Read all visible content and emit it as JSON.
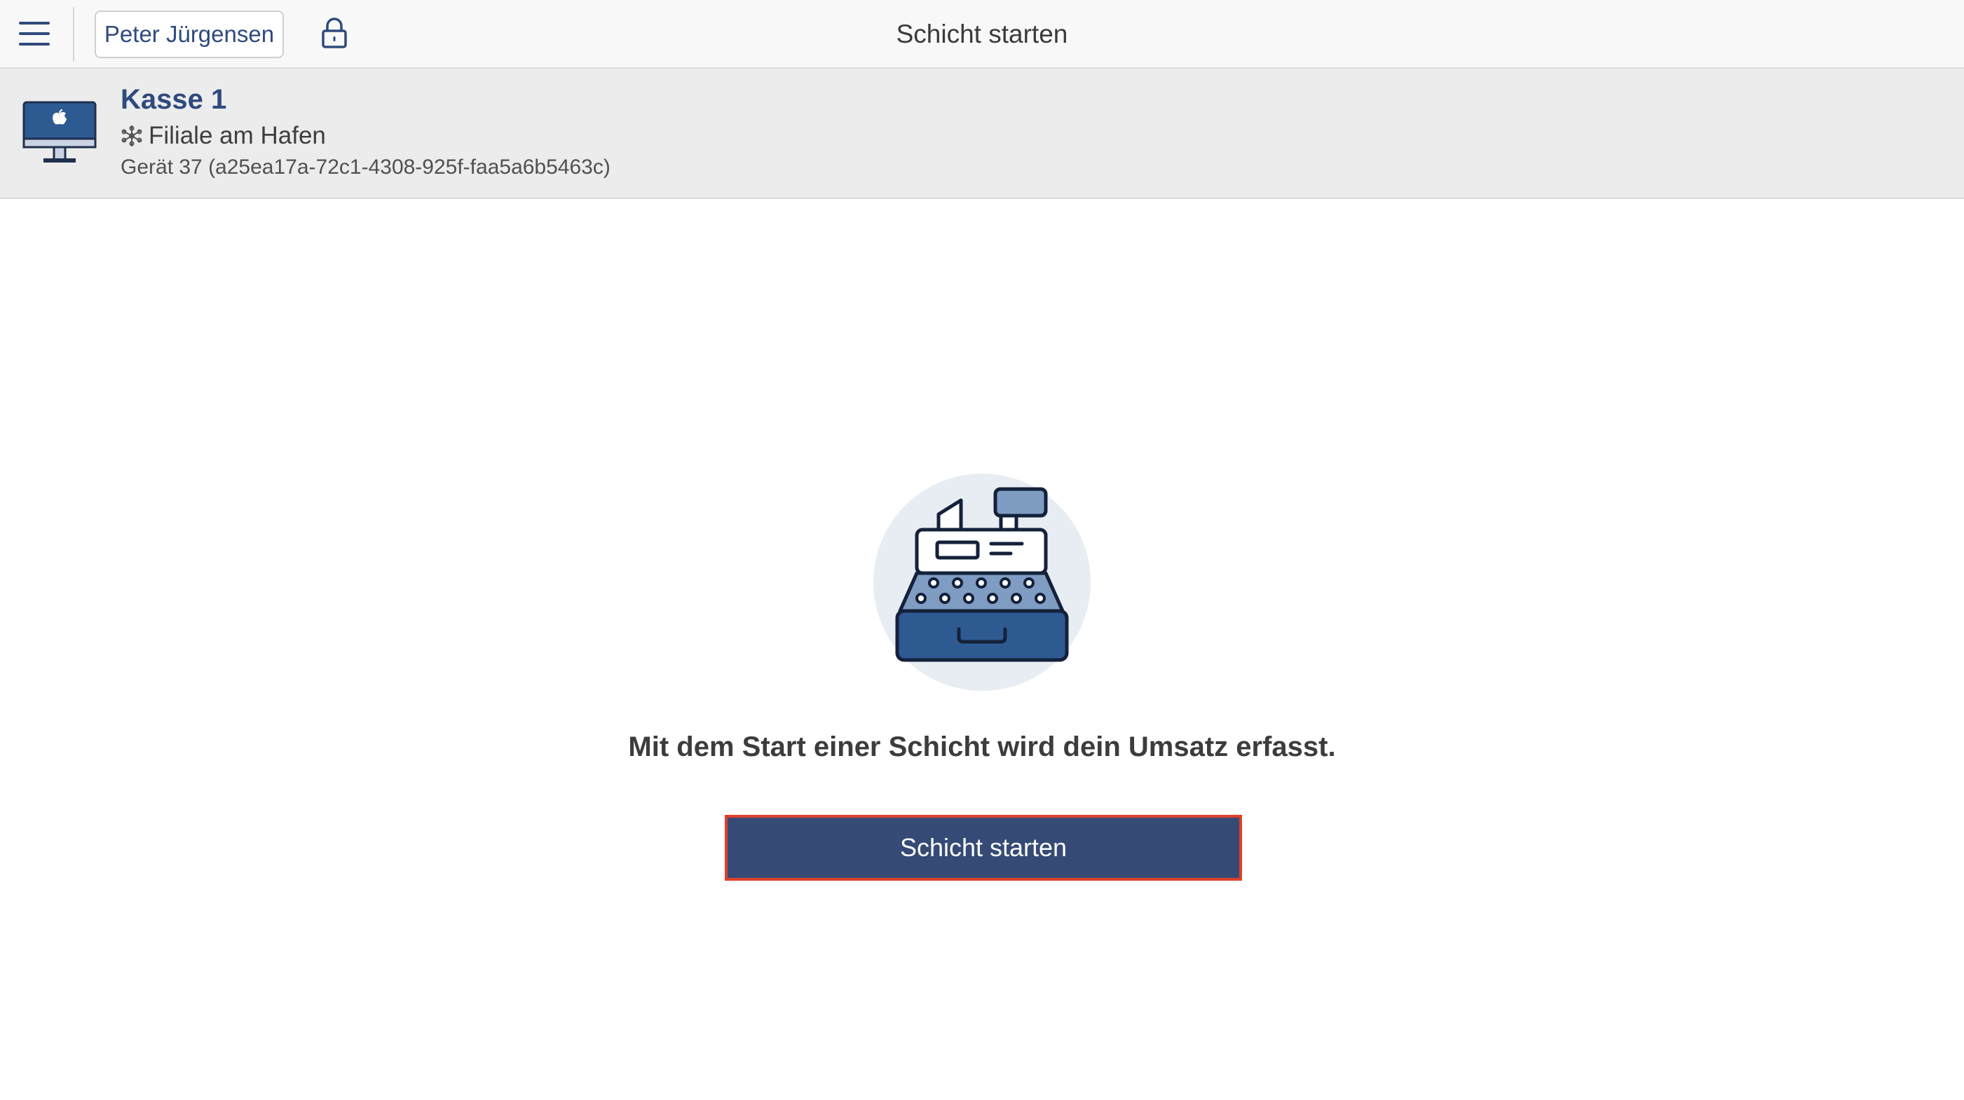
{
  "topbar": {
    "menu_icon": "hamburger-menu-icon",
    "user_name": "Peter Jürgensen",
    "lock_icon": "lock-icon",
    "title": "Schicht starten"
  },
  "device": {
    "icon": "desktop-computer-icon",
    "name": "Kasse 1",
    "branch_icon": "snowflake-icon",
    "branch": "Filiale am Hafen",
    "id_line": "Gerät 37 (a25ea17a-72c1-4308-925f-faa5a6b5463c)"
  },
  "main": {
    "illustration": "cash-register-illustration",
    "info_text": "Mit dem Start einer Schicht wird dein Umsatz erfasst.",
    "start_button_label": "Schicht starten"
  },
  "colors": {
    "brand_blue": "#354b76",
    "accent_blue": "#2f4a7c",
    "focus_red": "#e0402a",
    "header_bg": "#ececec"
  }
}
